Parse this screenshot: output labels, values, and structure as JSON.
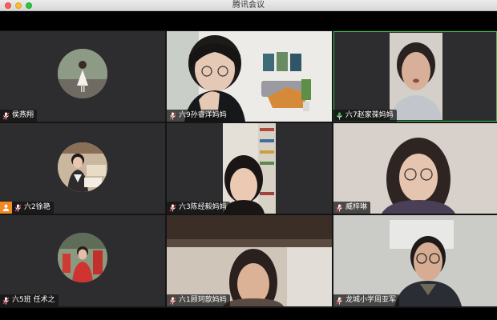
{
  "window": {
    "title": "腾讯会议"
  },
  "participants": [
    {
      "name": "侯燕翔",
      "mic": "muted"
    },
    {
      "name": "六9孙睿洋妈妈",
      "mic": "muted"
    },
    {
      "name": "六7赵家葆妈妈",
      "mic": "speaking"
    },
    {
      "name": "六2徐艳",
      "mic": "muted",
      "badge": "host"
    },
    {
      "name": "六3陈经毅妈妈",
      "mic": "muted"
    },
    {
      "name": "臧梓琳",
      "mic": "muted"
    },
    {
      "name": "六5班 任术之",
      "mic": "muted"
    },
    {
      "name": "六1顾珂歆妈妈",
      "mic": "muted"
    },
    {
      "name": "龙城小学周亚军",
      "mic": "muted"
    }
  ],
  "colors": {
    "speaking": "#35c24a",
    "host_badge": "#f08a24",
    "tile_bg": "#2d2d2f"
  }
}
